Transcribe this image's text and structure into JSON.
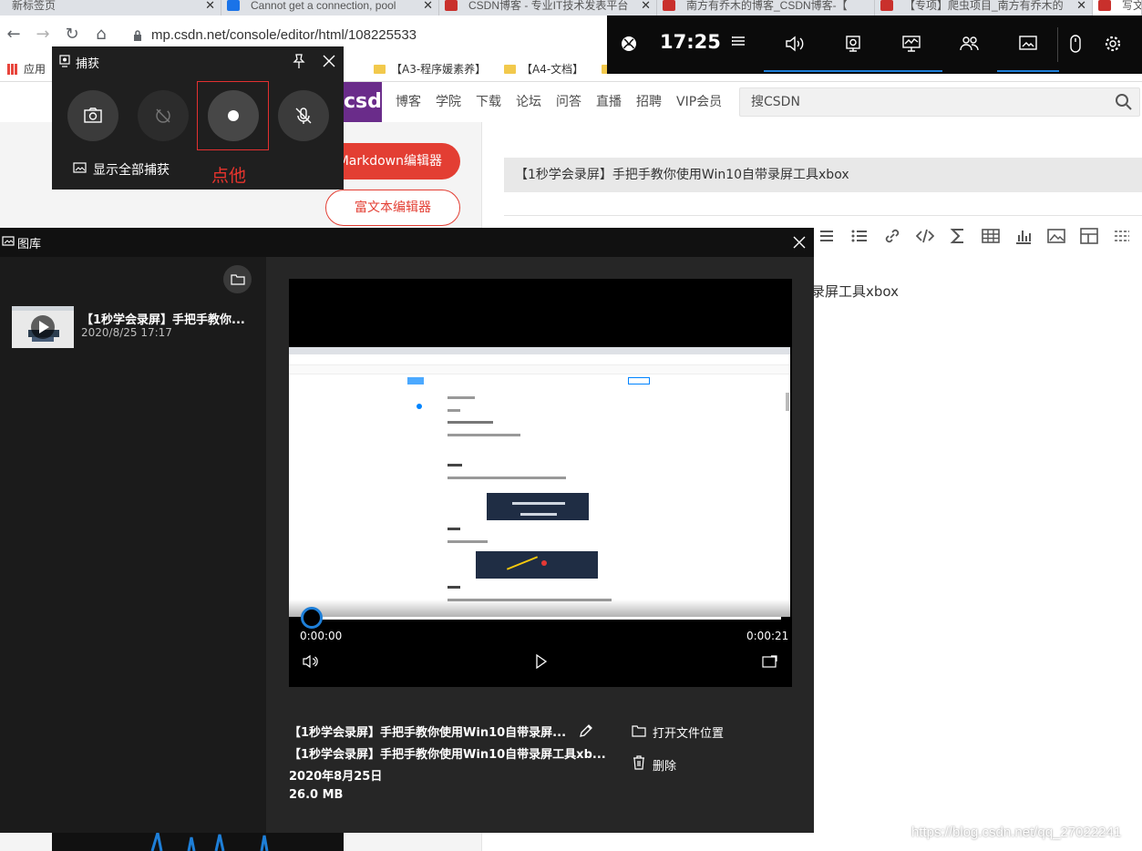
{
  "browser": {
    "tabs": [
      {
        "label": "新标签页",
        "icon": "new-tab-icon"
      },
      {
        "label": "Cannot get a connection, pool",
        "icon": "blue-favicon-icon"
      },
      {
        "label": "CSDN博客 - 专业IT技术发表平台",
        "icon": "csdn-favicon-icon"
      },
      {
        "label": "南方有乔木的博客_CSDN博客-【",
        "icon": "csdn-favicon-icon"
      },
      {
        "label": "【专项】爬虫项目_南方有乔木的",
        "icon": "csdn-favicon-icon"
      },
      {
        "label": "写文",
        "icon": "csdn-favicon-icon"
      }
    ],
    "url": "mp.csdn.net/console/editor/html/108225533",
    "bookmarks": [
      {
        "label": "应用",
        "icon": "apps-icon"
      },
      {
        "label": "【A3-程序媛素养】",
        "icon": "folder-icon"
      },
      {
        "label": "【A4-文档】",
        "icon": "folder-icon"
      }
    ]
  },
  "csdn": {
    "logo": "csdn",
    "nav": [
      "博客",
      "学院",
      "下载",
      "论坛",
      "问答",
      "直播",
      "招聘",
      "VIP会员"
    ],
    "search_placeholder": "搜CSDN",
    "markdown_button": "Markdown编辑器",
    "richtext_button": "富文本编辑器",
    "article_title": "【1秒学会录屏】手把手教你使用Win10自带录屏工具xbox",
    "body_text_visible": "录屏工具xbox",
    "watermark": "https://blog.csdn.net/qq_27022241",
    "brand_color": "#e33e33"
  },
  "xbox_bar": {
    "time": "17:25",
    "widgets": [
      "menu-icon",
      "audio-icon",
      "capture-icon",
      "performance-icon",
      "social-icon",
      "gallery-icon",
      "mouse-icon",
      "settings-icon"
    ],
    "accent": "#1e7fd8"
  },
  "capture": {
    "title": "捕获",
    "show_all": "显示全部捕获",
    "hint": "点他",
    "hint_color": "#e8342d",
    "buttons": [
      "screenshot-icon",
      "record-last-icon",
      "record-start-icon",
      "mic-off-icon"
    ]
  },
  "gallery": {
    "title": "图库",
    "item": {
      "name": "【1秒学会录屏】手把手教你...",
      "date": "2020/8/25 17:17"
    },
    "player": {
      "current_time": "0:00:00",
      "duration": "0:00:21",
      "progress": 0.0
    },
    "info": {
      "line1": "【1秒学会录屏】手把手教你使用Win10自带录屏...",
      "line2": "【1秒学会录屏】手把手教你使用Win10自带录屏工具xb...",
      "date": "2020年8月25日",
      "size": "26.0 MB"
    },
    "actions": {
      "open_location": "打开文件位置",
      "delete": "删除"
    }
  }
}
